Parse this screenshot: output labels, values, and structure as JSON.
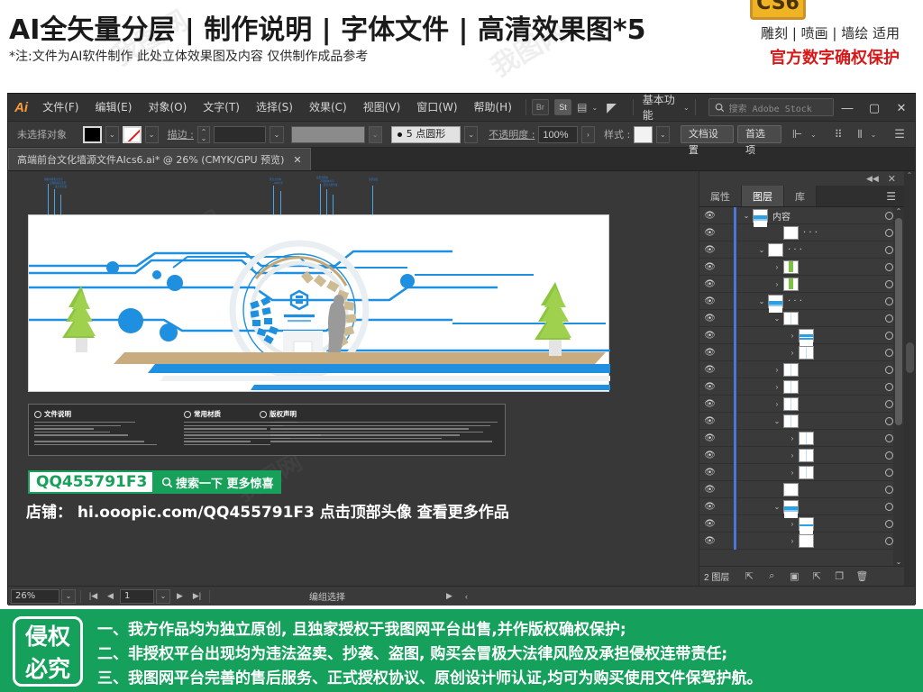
{
  "promo": {
    "title": "AI全矢量分层 | 制作说明 | 字体文件 | 高清效果图*5",
    "subtitle": "*注:文件为AI软件制作 此处立体效果图及内容 仅供制作成品参考",
    "badge": "CS6",
    "right_line1": "雕刻 | 喷画 | 墙绘 适用",
    "right_line2": "官方数字确权保护",
    "watermark": "我图网"
  },
  "app": {
    "logo": "Ai",
    "menus": [
      "文件(F)",
      "编辑(E)",
      "对象(O)",
      "文字(T)",
      "选择(S)",
      "效果(C)",
      "视图(V)",
      "窗口(W)",
      "帮助(H)"
    ],
    "bridge_button": "Br",
    "stock_button": "St",
    "workspace": "基本功能",
    "stock_search_placeholder": "搜索 Adobe Stock",
    "window_controls": {
      "minimize": "—",
      "maximize": "▢",
      "close": "✕"
    }
  },
  "optionbar": {
    "selection_status": "未选择对象",
    "stroke_label": "描边 :",
    "stroke_weight": "",
    "stroke_profile": "5 点圆形",
    "opacity_label": "不透明度 :",
    "opacity_value": "100%",
    "style_label": "样式 :",
    "document_setup": "文档设置",
    "preferences": "首选项"
  },
  "document": {
    "tab_title": "高端前台文化墙源文件AIcs6.ai* @ 26% (CMYK/GPU 预览)",
    "close_glyph": "✕"
  },
  "artwork": {
    "annotations": [
      "钢板烤漆亚克力字",
      "铝塑板基层造型",
      "发光字灯箱",
      "亚克力字体",
      "LED灯带",
      "造型基层板",
      "不锈钢拉丝字",
      "亚克力透光板",
      "造型基层"
    ],
    "info_panel": {
      "sections": [
        {
          "icon": "document-icon",
          "title": "文件说明"
        },
        {
          "icon": "material-icon",
          "title": "常用材质"
        },
        {
          "icon": "copyright-icon",
          "title": "版权声明"
        }
      ]
    }
  },
  "shop_promo": {
    "qq_code": "QQ455791F3",
    "search_button": "搜索一下 更多惊喜",
    "search_icon": "search-icon",
    "shop_line": "店铺： hi.ooopic.com/QQ455791F3   点击顶部头像 查看更多作品"
  },
  "panel": {
    "collapse_glyph": "◀◀",
    "close_glyph": "✕",
    "menu_glyph": "☰",
    "tabs": [
      {
        "label": "属性",
        "active": false
      },
      {
        "label": "图层",
        "active": true
      },
      {
        "label": "库",
        "active": false
      }
    ],
    "layer_count_label": "2 图层",
    "footer_icons": [
      "locate-object-icon",
      "search-icon",
      "make-clipping-mask-icon",
      "create-new-sublayer-icon",
      "create-new-layer-icon",
      "delete-selection-icon"
    ],
    "rows": [
      {
        "name": "内容",
        "depth": 0,
        "twirl": "down",
        "thumb": "art"
      },
      {
        "name": "· · ·",
        "depth": 2,
        "twirl": "none",
        "thumb": "blank"
      },
      {
        "name": "· · ·",
        "depth": 1,
        "twirl": "down",
        "thumb": "blank"
      },
      {
        "name": "",
        "depth": 2,
        "twirl": "right",
        "thumb": "tree"
      },
      {
        "name": "",
        "depth": 2,
        "twirl": "right",
        "thumb": "tree"
      },
      {
        "name": "· · ·",
        "depth": 1,
        "twirl": "down",
        "thumb": "art"
      },
      {
        "name": "",
        "depth": 2,
        "twirl": "down",
        "thumb": "pale"
      },
      {
        "name": "",
        "depth": 3,
        "twirl": "right",
        "thumb": "circuit"
      },
      {
        "name": "",
        "depth": 3,
        "twirl": "right",
        "thumb": "pale"
      },
      {
        "name": "",
        "depth": 2,
        "twirl": "right",
        "thumb": "pale"
      },
      {
        "name": "",
        "depth": 2,
        "twirl": "right",
        "thumb": "pale"
      },
      {
        "name": "",
        "depth": 2,
        "twirl": "right",
        "thumb": "pale"
      },
      {
        "name": "",
        "depth": 2,
        "twirl": "down",
        "thumb": "pale"
      },
      {
        "name": "",
        "depth": 3,
        "twirl": "right",
        "thumb": "pale"
      },
      {
        "name": "",
        "depth": 3,
        "twirl": "right",
        "thumb": "pale"
      },
      {
        "name": "",
        "depth": 3,
        "twirl": "right",
        "thumb": "pale"
      },
      {
        "name": "",
        "depth": 2,
        "twirl": "none",
        "thumb": "blank"
      },
      {
        "name": "",
        "depth": 2,
        "twirl": "down",
        "thumb": "art"
      },
      {
        "name": "",
        "depth": 3,
        "twirl": "right",
        "thumb": "line"
      },
      {
        "name": "",
        "depth": 3,
        "twirl": "right",
        "thumb": "blank"
      }
    ]
  },
  "statusbar": {
    "zoom": "26%",
    "first_glyph": "|◀",
    "prev_glyph": "◀",
    "artboard": "1",
    "next_glyph": "▶",
    "last_glyph": "▶|",
    "tool_status": "编组选择",
    "play_glyph": "▶",
    "resize_glyph": "‹"
  },
  "notice": {
    "seal_top": "侵权",
    "seal_bottom": "必究",
    "lines": [
      "一、我方作品均为独立原创, 且独家授权于我图网平台出售,并作版权确权保护;",
      "二、非授权平台出现均为违法盗卖、抄袭、盗图, 购买会冒极大法律风险及承担侵权连带责任;",
      "三、我图网平台完善的售后服务、正式授权协议、原创设计师认证,均可为购买使用文件保驾护航。"
    ]
  },
  "colors": {
    "brand_green": "#15a05c",
    "accent_red": "#d81818",
    "badge_gold": "#f0b323",
    "art_blue": "#1f8fe0",
    "layer_select_blue": "#4a76d4",
    "ai_orange": "#f59b3c"
  }
}
